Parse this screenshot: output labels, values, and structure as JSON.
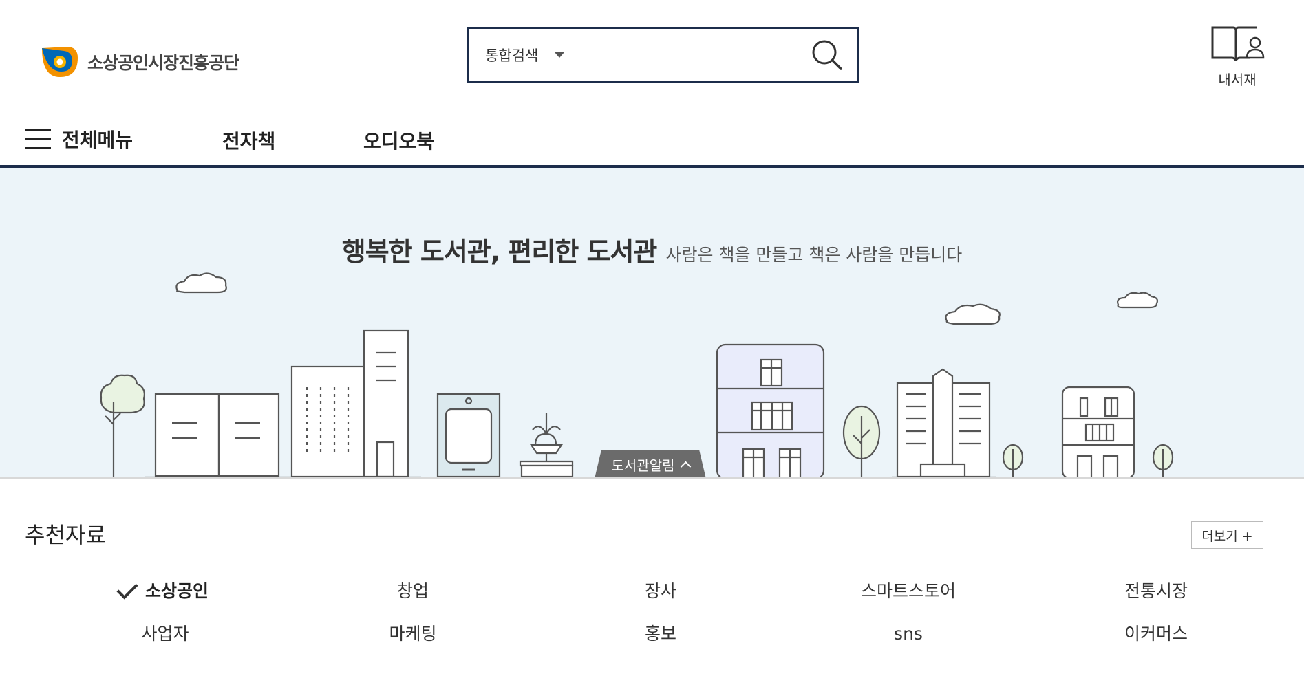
{
  "header": {
    "logo_text": "소상공인시장진흥공단",
    "search": {
      "select_value": "통합검색",
      "placeholder": "",
      "value": ""
    },
    "mylib_label": "내서재"
  },
  "nav": {
    "all_menu": "전체메뉴",
    "items": [
      "전자책",
      "오디오북"
    ]
  },
  "hero": {
    "title_main": "행복한 도서관, 편리한 도서관",
    "title_sub": "사람은 책을 만들고 책은 사람을 만듭니다",
    "notice_tab": "도서관알림"
  },
  "recommended": {
    "title": "추천자료",
    "more_label": "더보기 +",
    "categories": [
      "소상공인",
      "창업",
      "장사",
      "스마트스토어",
      "전통시장",
      "사업자",
      "마케팅",
      "홍보",
      "sns",
      "이커머스"
    ],
    "active_index": 0
  },
  "colors": {
    "accent_navy": "#1c2d4b",
    "hero_bg": "#ecf4f9",
    "tab_gray": "#6b6b6b",
    "logo_orange": "#f39200",
    "logo_blue": "#0068b7"
  }
}
